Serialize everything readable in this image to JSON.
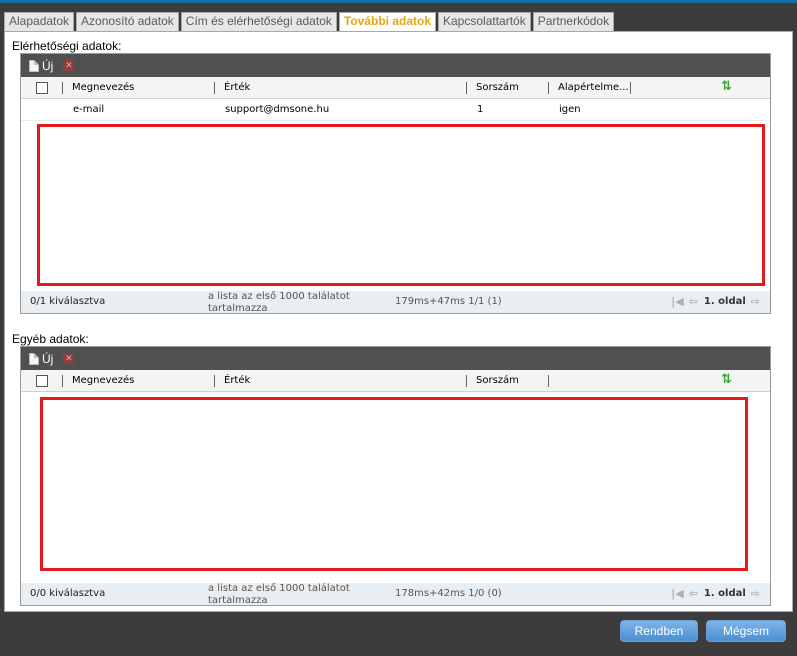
{
  "tabs": [
    {
      "label": "Alapadatok"
    },
    {
      "label": "Azonosító adatok"
    },
    {
      "label": "Cím és elérhetőségi adatok"
    },
    {
      "label": "További adatok"
    },
    {
      "label": "Kapcsolattartók"
    },
    {
      "label": "Partnerkódok"
    }
  ],
  "active_tab": "További adatok",
  "contact_section": {
    "title": "Elérhetőségi adatok:",
    "toolbar": {
      "new_label": "Új"
    },
    "columns": [
      "Megnevezés",
      "Érték",
      "Sorszám",
      "Alapértelme..."
    ],
    "rows": [
      {
        "name": "e-mail",
        "value": "support@dmsone.hu",
        "order": "1",
        "default": "igen"
      }
    ],
    "footer": {
      "selected": "0/1 kiválasztva",
      "info": "a lista az első 1000 találatot tartalmazza",
      "timing": "179ms+47ms 1/1 (1)",
      "page": "1. oldal"
    }
  },
  "other_section": {
    "title": "Egyéb adatok:",
    "toolbar": {
      "new_label": "Új"
    },
    "columns": [
      "Megnevezés",
      "Érték",
      "Sorszám"
    ],
    "footer": {
      "selected": "0/0 kiválasztva",
      "info": "a lista az első 1000 találatot tartalmazza",
      "timing": "178ms+42ms 1/0 (0)",
      "page": "1. oldal"
    }
  },
  "buttons": {
    "ok": "Rendben",
    "cancel": "Mégsem"
  },
  "colors": {
    "active_tab": "#e8a418",
    "toolbar": "#505050",
    "highlight": "#e11a1a",
    "button": "#4a8fd0"
  },
  "icons": [
    "new-document-icon",
    "delete-icon",
    "refresh-icon",
    "first-page-icon",
    "prev-page-icon",
    "next-page-icon"
  ]
}
